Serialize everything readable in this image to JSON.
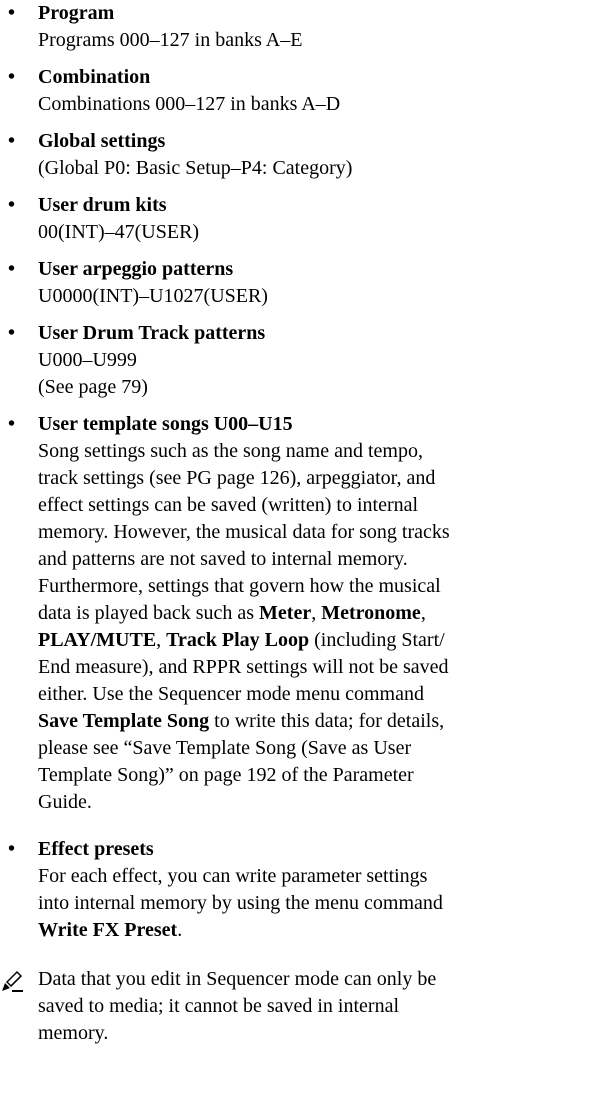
{
  "items": [
    {
      "title": "Program",
      "lines": [
        "Programs 000–127 in banks A–E"
      ]
    },
    {
      "title": "Combination",
      "lines": [
        "Combinations 000–127 in banks A–D"
      ]
    },
    {
      "title": "Global settings",
      "lines": [
        "(Global P0: Basic Setup–P4: Category)"
      ]
    },
    {
      "title": "User drum kits",
      "lines": [
        "00(INT)–47(USER)"
      ]
    },
    {
      "title": "User arpeggio patterns",
      "lines": [
        "U0000(INT)–U1027(USER)"
      ]
    },
    {
      "title": "User Drum Track patterns",
      "lines": [
        "U000–U999",
        "(See page 79)"
      ]
    },
    {
      "title": "User template songs U00–U15"
    },
    {
      "title": "Effect presets"
    }
  ],
  "template_songs_para": {
    "l1": "Song settings such as the song name and tempo,",
    "l2": "track settings (see PG page 126), arpeggiator, and",
    "l3": "effect settings can be saved (written) to internal",
    "l4": "memory. However, the musical data for song tracks",
    "l5": "and patterns are not saved to internal memory.",
    "l6": "Furthermore, settings that govern how the musical",
    "l7a": "data is played back such as ",
    "meter": "Meter",
    "comma1": ", ",
    "metronome": "Metronome",
    "comma2": ",",
    "play_mute": "PLAY/MUTE",
    "comma3": ", ",
    "track_play_loop": "Track Play Loop",
    "l8b": " (including Start/",
    "l9": "End measure), and RPPR settings will not be saved",
    "l10": "either. Use the Sequencer mode menu command",
    "save_template_song": "Save Template Song",
    "l11b": " to write this data; for details,",
    "l12": "please see “Save Template Song (Save as User",
    "l13": "Template Song)” on page 192 of the Parameter",
    "l14": "Guide."
  },
  "effect_presets_para": {
    "l1": "For each effect, you can write parameter settings",
    "l2": "into internal memory by using the menu command",
    "write_fx_preset": "Write FX Preset",
    "period": "."
  },
  "note": {
    "icon": "pencil-note-icon",
    "l1": "Data that you edit in Sequencer mode can only be",
    "l2": "saved to media; it cannot be saved in internal",
    "l3": "memory."
  },
  "bullet_char": "•"
}
